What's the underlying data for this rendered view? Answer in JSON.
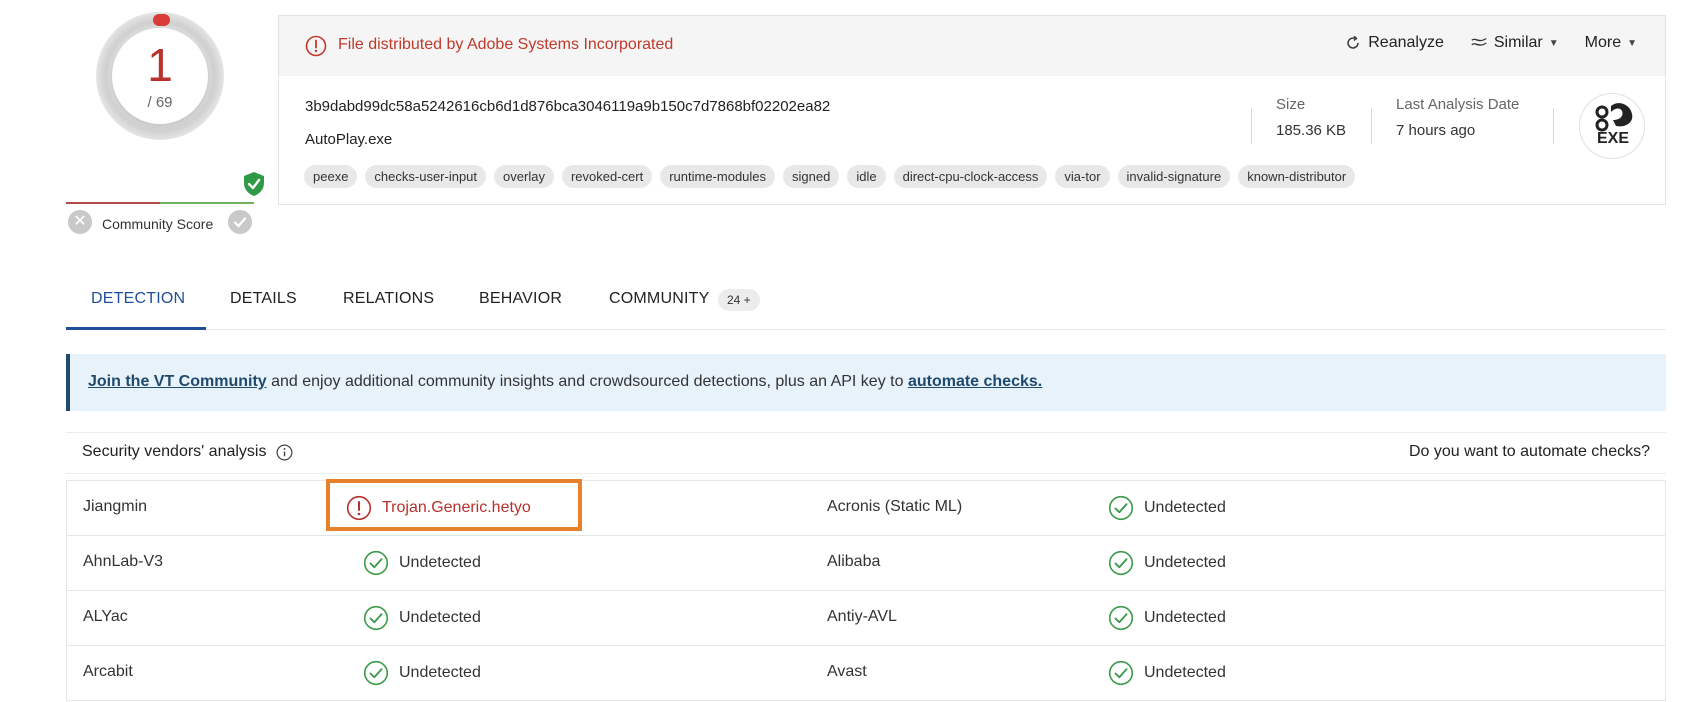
{
  "score": {
    "detections": "1",
    "total": "/ 69",
    "community_label": "Community Score"
  },
  "file": {
    "alert": "File distributed by Adobe Systems Incorporated",
    "hash": "3b9dabd99dc58a5242616cb6d1d876bca3046119a9b150c7d7868bf02202ea82",
    "name": "AutoPlay.exe",
    "tags": [
      "peexe",
      "checks-user-input",
      "overlay",
      "revoked-cert",
      "runtime-modules",
      "signed",
      "idle",
      "direct-cpu-clock-access",
      "via-tor",
      "invalid-signature",
      "known-distributor"
    ],
    "size_label": "Size",
    "size_value": "185.36 KB",
    "date_label": "Last Analysis Date",
    "date_value": "7 hours ago",
    "type_label": "EXE"
  },
  "actions": {
    "reanalyze": "Reanalyze",
    "similar": "Similar",
    "more": "More"
  },
  "tabs": {
    "detection": "DETECTION",
    "details": "DETAILS",
    "relations": "RELATIONS",
    "behavior": "BEHAVIOR",
    "community": "COMMUNITY",
    "community_badge": "24 +"
  },
  "banner": {
    "link1": "Join the VT Community",
    "middle": " and enjoy additional community insights and crowdsourced detections, plus an API key to ",
    "link2": "automate checks."
  },
  "vendors": {
    "title": "Security vendors' analysis",
    "automate": "Do you want to automate checks?",
    "rows": [
      {
        "v1": "Jiangmin",
        "r1": "Trojan.Generic.hetyo",
        "r1_malicious": true,
        "v2": "Acronis (Static ML)",
        "r2": "Undetected"
      },
      {
        "v1": "AhnLab-V3",
        "r1": "Undetected",
        "r1_malicious": false,
        "v2": "Alibaba",
        "r2": "Undetected"
      },
      {
        "v1": "ALYac",
        "r1": "Undetected",
        "r1_malicious": false,
        "v2": "Antiy-AVL",
        "r2": "Undetected"
      },
      {
        "v1": "Arcabit",
        "r1": "Undetected",
        "r1_malicious": false,
        "v2": "Avast",
        "r2": "Undetected"
      }
    ]
  },
  "colors": {
    "malicious": "#b8312d",
    "clean": "#3c9a4a",
    "accent": "#1f4e9a",
    "highlight": "#e8812b"
  },
  "icons": {
    "alert": "alert-circle-icon",
    "reanalyze": "refresh-icon",
    "similar": "similar-icon",
    "clean": "check-circle-icon",
    "info": "info-icon"
  }
}
